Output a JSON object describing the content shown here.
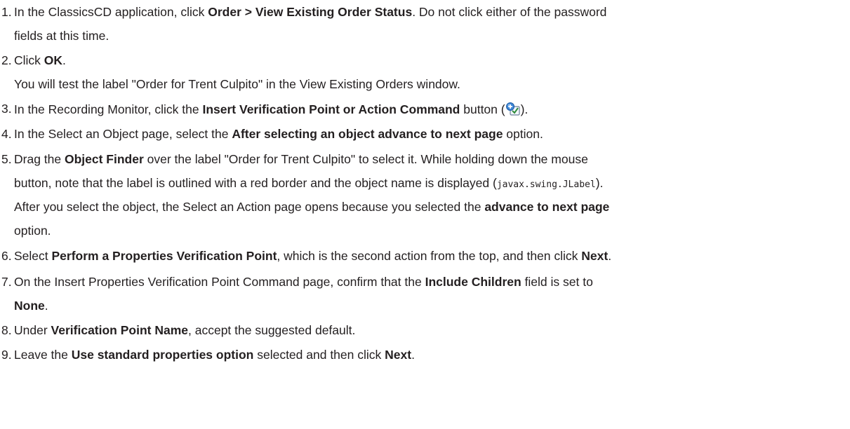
{
  "steps": [
    {
      "number": "1.",
      "parts": {
        "a": "In the ClassicsCD application, click ",
        "b1": "Order > View Existing Order Status",
        "c": ". Do not click either of the password",
        "d": "fields at this time."
      }
    },
    {
      "number": "2.",
      "parts": {
        "a": "Click ",
        "b1": "OK",
        "c": ".",
        "d": "You will test the label \"Order for Trent Culpito\" in the View Existing Orders window."
      }
    },
    {
      "number": "3.",
      "parts": {
        "a": "In the Recording Monitor, click the ",
        "b1": "Insert Verification Point or Action Command",
        "c": " button (",
        "d": ")."
      },
      "icon": "insert-verification-point-icon"
    },
    {
      "number": "4.",
      "parts": {
        "a": "In the Select an Object page, select the ",
        "b1": "After selecting an object advance to next page",
        "c": " option."
      }
    },
    {
      "number": "5.",
      "parts": {
        "a": "Drag the ",
        "b1": "Object Finder",
        "c": " over the label \"Order for Trent Culpito\" to select it. While holding down the mouse",
        "d": "button, note that the label is outlined with a red border and the object name is displayed (",
        "code": "javax.swing.JLabel",
        "e": ").",
        "f": "After you select the object, the Select an Action page opens because you selected the ",
        "b2": "advance to next page",
        "g": "option."
      }
    },
    {
      "number": "6.",
      "parts": {
        "a": "Select ",
        "b1": "Perform a Properties Verification Point",
        "c": ", which is the second action from the top, and then click ",
        "b2": "Next",
        "d": "."
      }
    },
    {
      "number": "7.",
      "parts": {
        "a": "On the Insert Properties Verification Point Command page, confirm that the ",
        "b1": "Include Children",
        "c": " field is set to",
        "b2": "None",
        "d": "."
      }
    },
    {
      "number": "8.",
      "parts": {
        "a": "Under ",
        "b1": "Verification Point Name",
        "c": ", accept the suggested default."
      }
    },
    {
      "number": "9.",
      "parts": {
        "a": "Leave the ",
        "b1": "Use standard properties option",
        "c": " selected and then click ",
        "b2": "Next",
        "d": "."
      }
    }
  ]
}
